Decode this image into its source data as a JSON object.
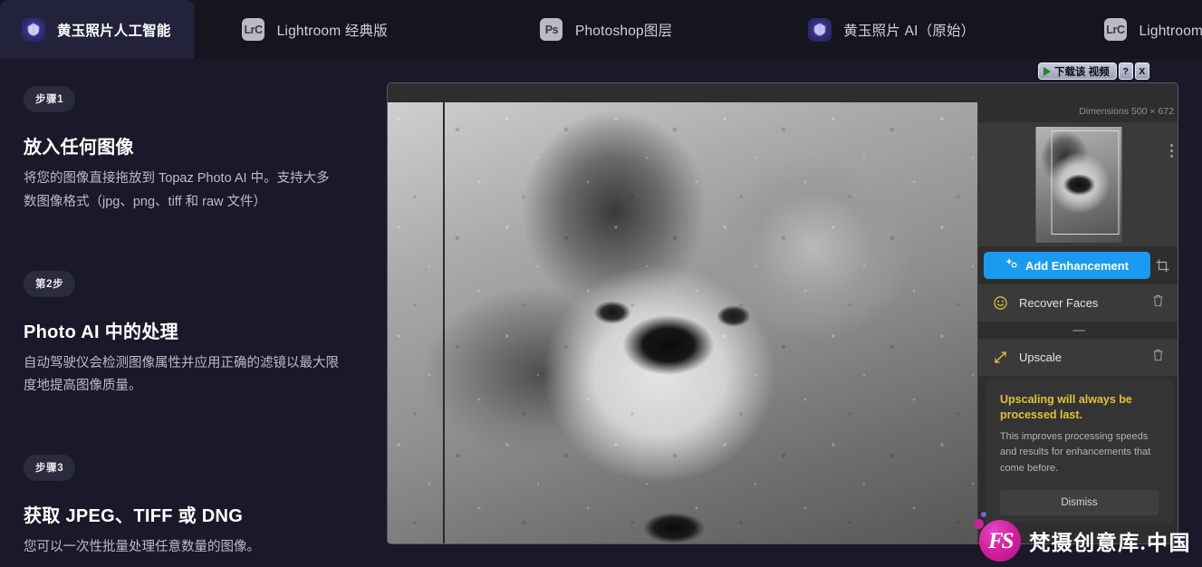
{
  "tabs": [
    {
      "label": "黄玉照片人工智能",
      "icon": "topaz-gem-icon",
      "active": true
    },
    {
      "label": "Lightroom 经典版",
      "icon": "lightroom-classic-icon",
      "active": false,
      "badge": "LrC"
    },
    {
      "label": "Photoshop图层",
      "icon": "photoshop-icon",
      "active": false,
      "badge": "Ps"
    },
    {
      "label": "黄玉照片 AI（原始）",
      "icon": "topaz-gem-icon",
      "active": false
    },
    {
      "label": "Lightroom 经典（原始）",
      "icon": "lightroom-classic-icon",
      "active": false,
      "badge": "LrC"
    }
  ],
  "steps": [
    {
      "badge": "步骤1",
      "title": "放入任何图像",
      "body": "将您的图像直接拖放到 Topaz Photo AI 中。支持大多数图像格式（jpg、png、tiff 和 raw 文件）"
    },
    {
      "badge": "第2步",
      "title": "Photo AI 中的处理",
      "body": "自动驾驶仪会检测图像属性并应用正确的滤镜以最大限度地提高图像质量。"
    },
    {
      "badge": "步骤3",
      "title": "获取 JPEG、TIFF 或 DNG",
      "body": "您可以一次性批量处理任意数量的图像。"
    }
  ],
  "download_bar": {
    "label": "下载该 视频",
    "help_label": "?",
    "close_label": "X"
  },
  "app": {
    "dimensions_label": "Dimensions",
    "dimensions_value": "500 × 672",
    "add_enhancement_label": "Add Enhancement",
    "enhancements": [
      {
        "name": "Recover Faces",
        "icon": "smiley-face-icon"
      },
      {
        "name": "Upscale",
        "icon": "diagonal-arrows-icon"
      }
    ],
    "notice": {
      "title": "Upscaling will always be processed last.",
      "body": "This improves processing speeds and results for enhancements that come before.",
      "dismiss_label": "Dismiss"
    }
  },
  "watermark": {
    "mark": "FS",
    "text": "梵摄创意库.中国"
  },
  "colors": {
    "page_bg": "#191929",
    "tabbar_bg": "#15151f",
    "active_tab_bg": "#22223a",
    "accent_blue": "#1a9bf0",
    "warning_yellow": "#e2c13b",
    "watermark_pink": "#d6229f"
  }
}
